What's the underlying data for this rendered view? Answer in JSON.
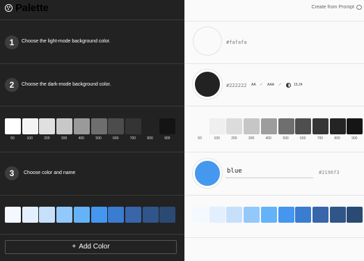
{
  "app": {
    "title": "Palette",
    "logo_icon": "palette-icon"
  },
  "header": {
    "prompt_label": "Create from Prompt",
    "prompt_icon": "chat-bubble-icon"
  },
  "steps": [
    {
      "num": "1",
      "text": "Choose the light-mode background color."
    },
    {
      "num": "2",
      "text": "Choose the dark-mode background color."
    },
    {
      "num": "3",
      "text": "Choose color and name"
    }
  ],
  "light_bg": {
    "hex": "#fafafa",
    "color": "#fafafa"
  },
  "dark_bg": {
    "hex": "#222222",
    "color": "#222222",
    "aa_label": "AA",
    "aaa_label": "AAA",
    "contrast_ratio": "15.24",
    "ratio_icon": "contrast-icon"
  },
  "shade_labels": [
    "50",
    "100",
    "200",
    "300",
    "400",
    "500",
    "600",
    "700",
    "800",
    "900"
  ],
  "gray_scale_left": [
    "#ffffff",
    "#f4f4f4",
    "#e0e0e0",
    "#c8c8c8",
    "#9a9a9a",
    "#6e6e6e",
    "#4c4c4c",
    "#343434",
    "#222222",
    "#141414"
  ],
  "gray_scale_right": [
    "#fafafa",
    "#efefef",
    "#dcdcdc",
    "#c6c6c6",
    "#9d9d9d",
    "#6f6f6f",
    "#4e4e4e",
    "#363636",
    "#242424",
    "#151515"
  ],
  "color_entry": {
    "name": "blue",
    "hex": "#2196f3",
    "color": "#4499ee"
  },
  "blue_scale": [
    "#f4f8ff",
    "#e3effd",
    "#c6e0fb",
    "#93c8fa",
    "#64b2f7",
    "#4496ee",
    "#3a7cd0",
    "#3766aa",
    "#2f5589",
    "#2a4a74"
  ],
  "add_button": {
    "label": "Add Color",
    "icon": "plus-icon"
  }
}
